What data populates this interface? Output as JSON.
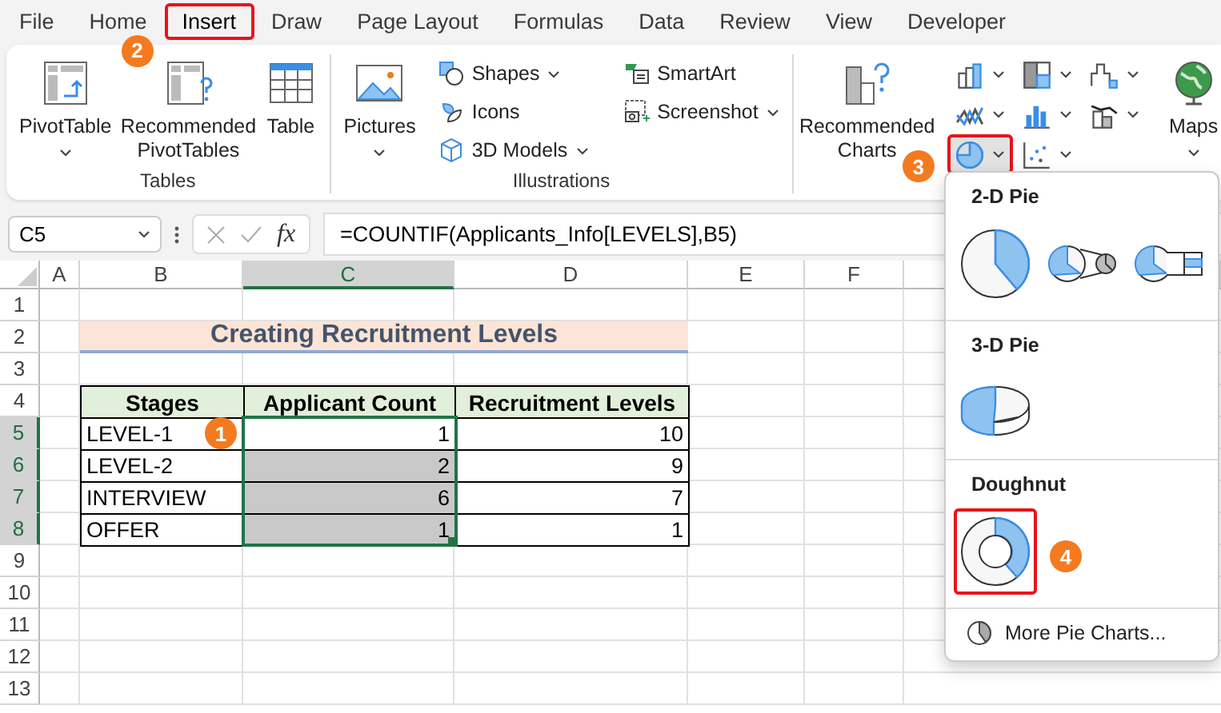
{
  "menu_tabs": [
    {
      "label": "File",
      "selected": false,
      "highlighted": false
    },
    {
      "label": "Home",
      "selected": false,
      "highlighted": false
    },
    {
      "label": "Insert",
      "selected": true,
      "highlighted": true,
      "callout": "2"
    },
    {
      "label": "Draw",
      "selected": false,
      "highlighted": false
    },
    {
      "label": "Page Layout",
      "selected": false,
      "highlighted": false
    },
    {
      "label": "Formulas",
      "selected": false,
      "highlighted": false
    },
    {
      "label": "Data",
      "selected": false,
      "highlighted": false
    },
    {
      "label": "Review",
      "selected": false,
      "highlighted": false
    },
    {
      "label": "View",
      "selected": false,
      "highlighted": false
    },
    {
      "label": "Developer",
      "selected": false,
      "highlighted": false
    }
  ],
  "ribbon": {
    "groups": [
      {
        "label": "Tables",
        "blocks": [
          {
            "kind": "large",
            "items": [
              {
                "label": "PivotTable",
                "kind": "pivot",
                "dropdown": true
              },
              {
                "label": "Recommended PivotTables",
                "kind": "recpivot",
                "dropdown": false
              },
              {
                "label": "Table",
                "kind": "table",
                "dropdown": false
              }
            ]
          }
        ]
      },
      {
        "label": "Illustrations",
        "blocks": [
          {
            "kind": "large",
            "items": [
              {
                "label": "Pictures",
                "kind": "pictures",
                "dropdown": true
              }
            ]
          },
          {
            "kind": "stack",
            "items": [
              {
                "label": "Shapes",
                "kind": "shapes",
                "dropdown": true
              },
              {
                "label": "Icons",
                "kind": "icons",
                "dropdown": false
              },
              {
                "label": "3D Models",
                "kind": "models",
                "dropdown": true
              },
              {
                "label": "SmartArt",
                "kind": "smartart",
                "dropdown": false
              },
              {
                "label": "Screenshot",
                "kind": "screenshot",
                "dropdown": true
              }
            ]
          }
        ]
      },
      {
        "blocks": [
          {
            "kind": "large",
            "items": [
              {
                "label": "Recommended Charts",
                "kind": "recharts",
                "dropdown": false
              }
            ]
          },
          {
            "kind": "gallery",
            "items": [
              {
                "kind": "column",
                "dropdown": true,
                "selected": false,
                "highlighted": false
              },
              {
                "kind": "treemap",
                "dropdown": true,
                "selected": false,
                "highlighted": false
              },
              {
                "kind": "waterfall",
                "dropdown": true,
                "selected": false,
                "highlighted": false
              },
              {
                "kind": "line",
                "dropdown": true,
                "selected": false,
                "highlighted": false
              },
              {
                "kind": "histogram",
                "dropdown": true,
                "selected": false,
                "highlighted": false
              },
              {
                "kind": "combo",
                "dropdown": true,
                "selected": false,
                "highlighted": false
              },
              {
                "kind": "pie",
                "dropdown": true,
                "selected": true,
                "highlighted": true,
                "callout": "3"
              },
              {
                "kind": "scatter",
                "dropdown": true,
                "selected": false,
                "highlighted": false
              }
            ]
          },
          {
            "kind": "large",
            "items": [
              {
                "label": "Maps",
                "kind": "maps",
                "dropdown": true
              }
            ]
          }
        ]
      }
    ]
  },
  "formula_bar": {
    "name_box": "C5",
    "function_button": "fx",
    "formula": "=COUNTIF(Applicants_Info[LEVELS],B5)"
  },
  "sheet": {
    "columns": [
      {
        "label": "A",
        "selected": false
      },
      {
        "label": "B",
        "selected": false
      },
      {
        "label": "C",
        "selected": true
      },
      {
        "label": "D",
        "selected": false
      },
      {
        "label": "E",
        "selected": false
      },
      {
        "label": "F",
        "selected": false
      }
    ],
    "rows": [
      {
        "label": "1",
        "selected": false
      },
      {
        "label": "2",
        "selected": false
      },
      {
        "label": "3",
        "selected": false
      },
      {
        "label": "4",
        "selected": false
      },
      {
        "label": "5",
        "selected": true
      },
      {
        "label": "6",
        "selected": true
      },
      {
        "label": "7",
        "selected": true
      },
      {
        "label": "8",
        "selected": true
      },
      {
        "label": "9",
        "selected": false
      },
      {
        "label": "10",
        "selected": false
      },
      {
        "label": "11",
        "selected": false
      },
      {
        "label": "12",
        "selected": false
      },
      {
        "label": "13",
        "selected": false
      }
    ],
    "title": "Creating Recruitment Levels",
    "table": {
      "columns": [
        "Stages",
        "Applicant Count",
        "Recruitment Levels"
      ],
      "rows": [
        {
          "cells": [
            "LEVEL-1",
            "1",
            "10"
          ],
          "selected": true,
          "active": true,
          "callout": "1"
        },
        {
          "cells": [
            "LEVEL-2",
            "2",
            "9"
          ],
          "selected": true,
          "active": false
        },
        {
          "cells": [
            "INTERVIEW",
            "6",
            "7"
          ],
          "selected": true,
          "active": false
        },
        {
          "cells": [
            "OFFER",
            "1",
            "1"
          ],
          "selected": true,
          "active": false
        }
      ]
    }
  },
  "pie_menu": {
    "sections": [
      {
        "title": "2-D Pie",
        "options": [
          {
            "kind": "pie",
            "highlighted": false
          },
          {
            "kind": "pieofpie",
            "highlighted": false
          },
          {
            "kind": "barofpie",
            "highlighted": false
          }
        ]
      },
      {
        "title": "3-D Pie",
        "options": [
          {
            "kind": "pie3d",
            "highlighted": false
          }
        ]
      },
      {
        "title": "Doughnut",
        "options": [
          {
            "kind": "doughnut",
            "highlighted": true,
            "callout": "4"
          }
        ]
      }
    ],
    "more": "More Pie Charts..."
  }
}
